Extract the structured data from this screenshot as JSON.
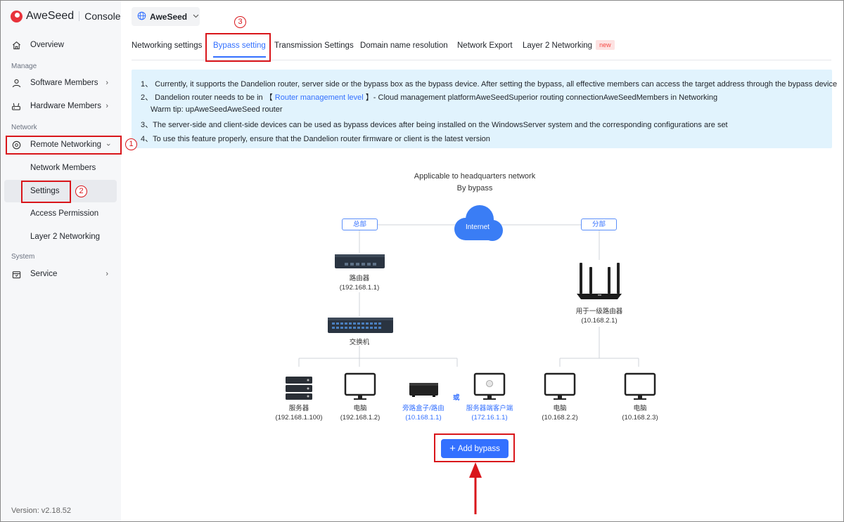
{
  "brand": {
    "name": "AweSeed",
    "console": "Console"
  },
  "sidebar": {
    "overview": "Overview",
    "manage_section": "Manage",
    "software_members": "Software Members",
    "hardware_members": "Hardware Members",
    "network_section": "Network",
    "remote_networking": "Remote Networking",
    "network_members": "Network Members",
    "settings": "Settings",
    "access_permission": "Access Permission",
    "layer2_networking": "Layer 2 Networking",
    "system_section": "System",
    "service": "Service",
    "version": "Version:  v2.18.52"
  },
  "project_selector": {
    "value": "AweSeed"
  },
  "tabs": [
    {
      "label": "Networking settings"
    },
    {
      "label": "Bypass setting"
    },
    {
      "label": "Transmission Settings"
    },
    {
      "label": "Domain name resolution"
    },
    {
      "label": "Network Export"
    },
    {
      "label": "Layer 2 Networking",
      "badge": "new"
    }
  ],
  "notice": {
    "line1": "1、  Currently, it supports the Dandelion router, server side or the bypass box as the bypass device. After setting the bypass, all effective members can access the target address through the bypass device",
    "line2_prefix": "2、 Dandelion router needs to be in 【 ",
    "line2_link": "Router management level",
    "line2_suffix": " 】- Cloud management platformAweSeedSuperior routing connectionAweSeedMembers in Networking",
    "line2_tip": "Warm tip: upAweSeedAweSeed router",
    "line3": "3、The server-side and client-side devices can be used as bypass devices after being installed on the WindowsServer system and the corresponding configurations are set",
    "line4": "4、To use this feature properly, ensure that the Dandelion router firmware or client is the latest version"
  },
  "diagram": {
    "title1": "Applicable to headquarters network",
    "title2": "By bypass",
    "internet": "Internet",
    "hq_tag": "总部",
    "branch_tag": "分部",
    "router_name": "路由器",
    "router_ip": "(192.168.1.1)",
    "switch_name": "交换机",
    "server_name": "服务器",
    "server_ip": "(192.168.1.100)",
    "pc1_name": "电脑",
    "pc1_ip": "(192.168.1.2)",
    "bypass_name": "旁路盒子/路由",
    "bypass_ip": "(10.168.1.1)",
    "or": "或",
    "client_name": "服务器端客户端",
    "client_ip": "(172.16.1.1)",
    "branch_router_name": "用于一级路由器",
    "branch_router_ip": "(10.168.2.1)",
    "pc2_name": "电脑",
    "pc2_ip": "(10.168.2.2)",
    "pc3_name": "电脑",
    "pc3_ip": "(10.168.2.3)"
  },
  "actions": {
    "add_bypass": "Add bypass"
  },
  "annotations": {
    "n1": "1",
    "n2": "2",
    "n3": "3"
  },
  "colors": {
    "accent": "#3370ff",
    "annotation": "#d9161b",
    "brand": "#e8323b",
    "notice_bg": "#e1f3fd"
  }
}
